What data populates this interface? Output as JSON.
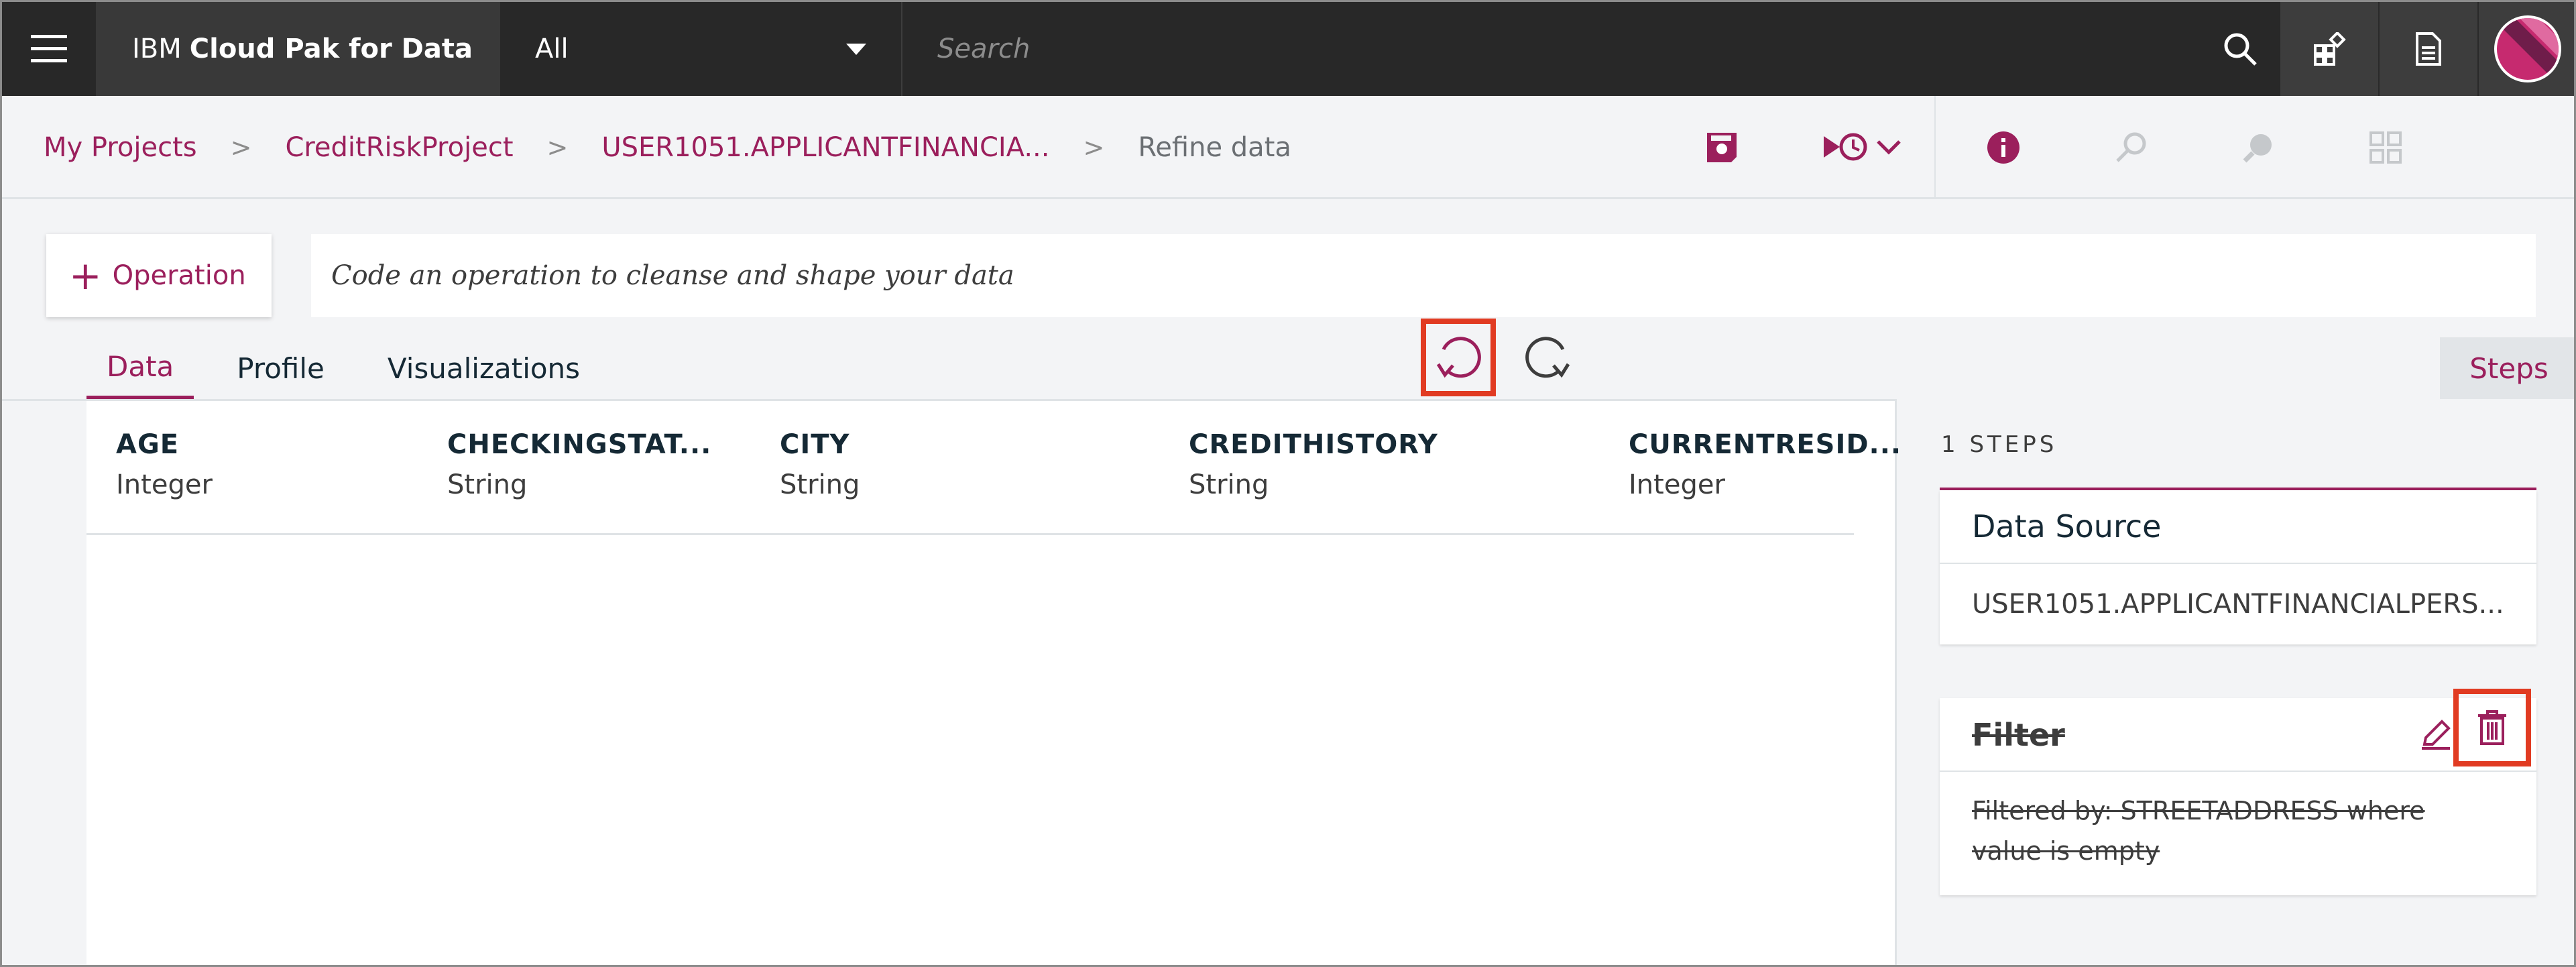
{
  "topbar": {
    "brand_prefix": "IBM",
    "brand_name": "Cloud Pak for Data",
    "scope_selected": "All",
    "search_placeholder": "Search"
  },
  "breadcrumb": {
    "items": [
      "My Projects",
      "CreditRiskProject",
      "USER1051.APPLICANTFINANCIA..."
    ],
    "current": "Refine data"
  },
  "toolbar": {
    "operation_label": "Operation",
    "code_placeholder": "Code an operation to cleanse and shape your data"
  },
  "tabs": [
    "Data",
    "Profile",
    "Visualizations"
  ],
  "active_tab": "Data",
  "steps_tab_label": "Steps",
  "table": {
    "columns": [
      {
        "name": "AGE",
        "type": "Integer"
      },
      {
        "name": "CHECKINGSTAT...",
        "type": "String"
      },
      {
        "name": "CITY",
        "type": "String"
      },
      {
        "name": "CREDITHISTORY",
        "type": "String"
      },
      {
        "name": "CURRENTRESID...",
        "type": "Integer"
      }
    ]
  },
  "steps": {
    "count_label": "1 STEPS",
    "data_source": {
      "title": "Data Source",
      "value": "USER1051.APPLICANTFINANCIALPERS..."
    },
    "filter": {
      "title": "Filter",
      "line1": "Filtered by: STREETADDRESS where",
      "line2": "value is empty"
    }
  },
  "colors": {
    "accent": "#9b1f5c",
    "highlight": "#e13b22",
    "topbar": "#282828"
  },
  "icons": [
    "hamburger-menu-icon",
    "caret-down-icon",
    "search-icon",
    "catalog-icon",
    "document-icon",
    "avatar",
    "save-icon",
    "history-icon",
    "chevron-down-icon",
    "info-icon",
    "wrench-icon",
    "paint-icon",
    "grid-icon",
    "undo-icon",
    "redo-icon",
    "plus-icon",
    "edit-icon",
    "trash-icon"
  ]
}
